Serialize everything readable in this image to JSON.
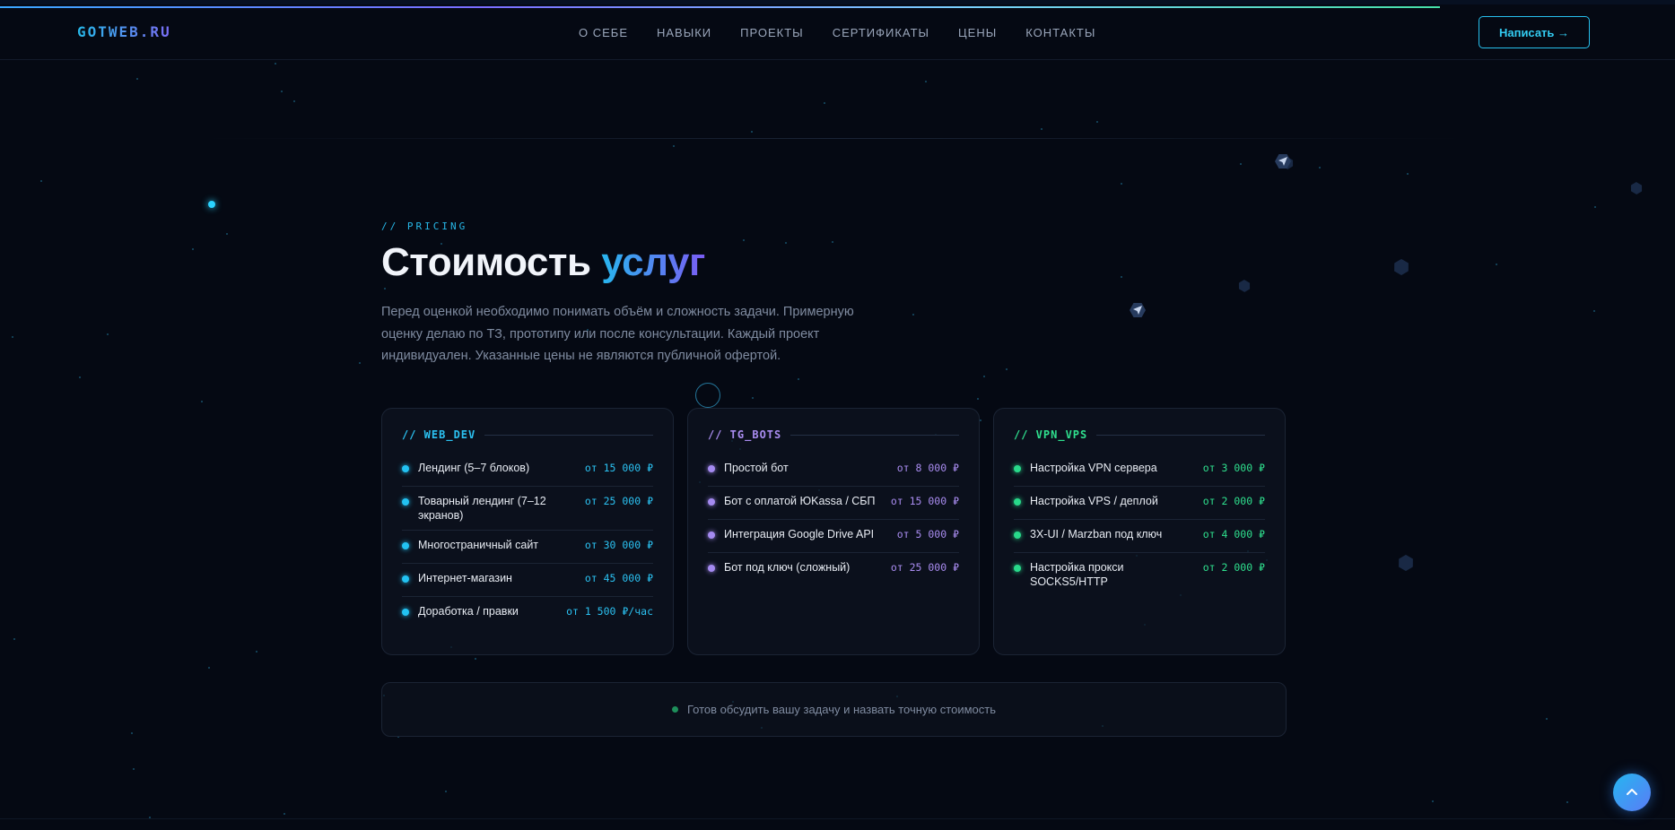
{
  "header": {
    "logo": "GOTWEB.RU",
    "nav": [
      "О СЕБЕ",
      "НАВЫКИ",
      "ПРОЕКТЫ",
      "СЕРТИФИКАТЫ",
      "ЦЕНЫ",
      "КОНТАКТЫ"
    ],
    "cta_label": "Написать →"
  },
  "pricing": {
    "eyebrow": "// PRICING",
    "title_main": "Стоимость",
    "title_accent": "услуг",
    "intro": "Перед оценкой необходимо понимать объём и сложность задачи. Примерную оценку делаю по ТЗ, прототипу или после консультации. Каждый проект индивидуален. Указанные цены не являются публичной офертой.",
    "cards": [
      {
        "tag": "// WEB_DEV",
        "accent": "#2bc2f2",
        "items": [
          {
            "name": "Лендинг (5–7 блоков)",
            "price": "от 15 000 ₽"
          },
          {
            "name": "Товарный лендинг (7–12 экранов)",
            "price": "от 25 000 ₽"
          },
          {
            "name": "Многостраничный сайт",
            "price": "от 30 000 ₽"
          },
          {
            "name": "Интернет-магазин",
            "price": "от 45 000 ₽"
          },
          {
            "name": "Доработка / правки",
            "price": "от 1 500 ₽/час"
          }
        ]
      },
      {
        "tag": "// TG_BOTS",
        "accent": "#a98cf0",
        "items": [
          {
            "name": "Простой бот",
            "price": "от 8 000 ₽"
          },
          {
            "name": "Бот с оплатой ЮKassa / СБП",
            "price": "от 15 000 ₽"
          },
          {
            "name": "Интеграция Google Drive API",
            "price": "от 5 000 ₽"
          },
          {
            "name": "Бот под ключ (сложный)",
            "price": "от 25 000 ₽"
          }
        ]
      },
      {
        "tag": "// VPN_VPS",
        "accent": "#2fe08e",
        "items": [
          {
            "name": "Настройка VPN сервера",
            "price": "от 3 000 ₽"
          },
          {
            "name": "Настройка VPS / деплой",
            "price": "от 2 000 ₽"
          },
          {
            "name": "3X-UI / Marzban под ключ",
            "price": "от 4 000 ₽"
          },
          {
            "name": "Настройка прокси SOCKS5/HTTP",
            "price": "от 2 000 ₽"
          }
        ]
      }
    ],
    "cta_text": "Готов обсудить вашу задачу и назвать точную стоимость"
  },
  "scroll_top_icon": "chevron-up-icon"
}
